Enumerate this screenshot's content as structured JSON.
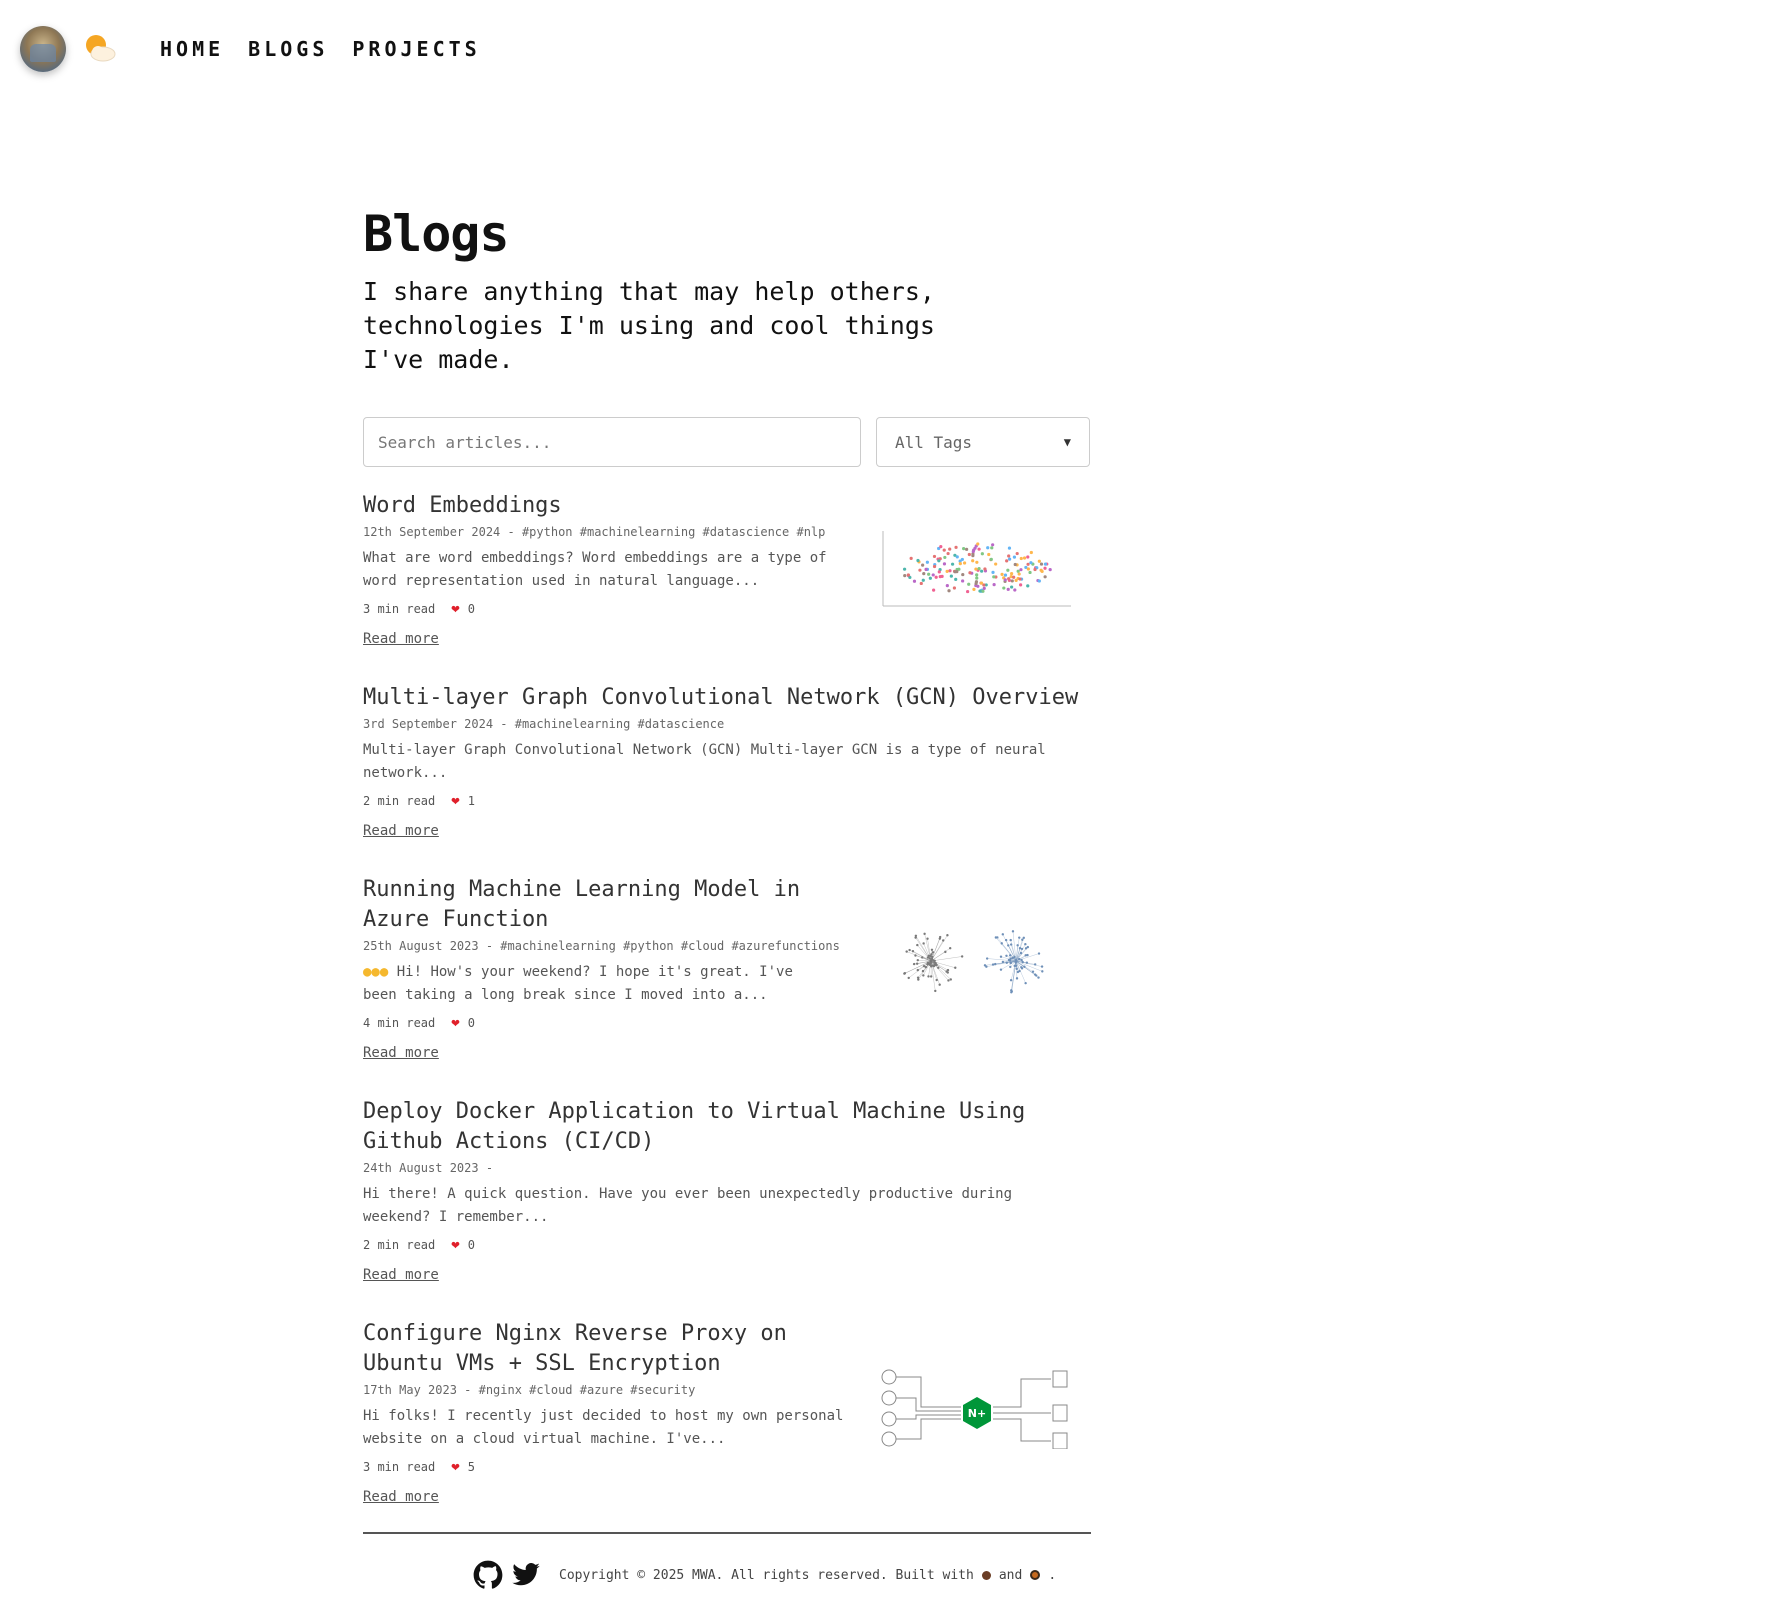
{
  "nav": {
    "links": [
      "HOME",
      "BLOGS",
      "PROJECTS"
    ]
  },
  "page": {
    "title": "Blogs",
    "subtitle": "I share anything that may help others, technologies I'm using and cool things I've made."
  },
  "search": {
    "placeholder": "Search articles..."
  },
  "tag_filter": {
    "selected": "All Tags"
  },
  "articles": [
    {
      "title": "Word Embeddings",
      "meta": "12th September 2024 - #python #machinelearning #datascience #nlp",
      "excerpt": "What are word embeddings? Word embeddings are a type of word representation used in natural language...",
      "read_time": "3 min read",
      "likes": "0",
      "read_more": "Read more"
    },
    {
      "title": "Multi-layer Graph Convolutional Network (GCN) Overview",
      "meta": "3rd September 2024 - #machinelearning #datascience",
      "excerpt": "Multi-layer Graph Convolutional Network (GCN) Multi-layer GCN is a type of neural network...",
      "read_time": "2 min read",
      "likes": "1",
      "read_more": "Read more"
    },
    {
      "title": "Running Machine Learning Model in Azure Function",
      "meta": "25th August 2023 - #machinelearning #python #cloud #azurefunctions",
      "excerpt": "Hi! How's your weekend? I hope it's great. I've been taking a long break since I moved into a...",
      "read_time": "4 min read",
      "likes": "0",
      "read_more": "Read more"
    },
    {
      "title": "Deploy Docker Application to Virtual Machine Using Github Actions (CI/CD)",
      "meta": "24th August 2023 -",
      "excerpt": "Hi there! A quick question. Have you ever been unexpectedly productive during weekend? I remember...",
      "read_time": "2 min read",
      "likes": "0",
      "read_more": "Read more"
    },
    {
      "title": "Configure Nginx Reverse Proxy on Ubuntu VMs + SSL Encryption",
      "meta": "17th May 2023 - #nginx #cloud #azure #security",
      "excerpt": "Hi folks! I recently just decided to host my own personal website on a cloud virtual machine. I've...",
      "read_time": "3 min read",
      "likes": "5",
      "read_more": "Read more",
      "thumb_label": "N+"
    }
  ],
  "footer": {
    "copyright": "Copyright © 2025 MWA. All rights reserved. Built with",
    "and": "and",
    "end": "."
  },
  "colors": {
    "heart": "#e0202b",
    "nginx_green": "#009639",
    "sun": "#f5b82e"
  }
}
